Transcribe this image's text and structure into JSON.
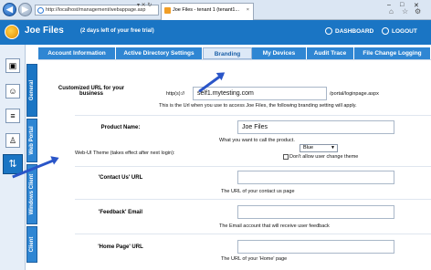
{
  "browser": {
    "url": "http://localhost/management/webappage.asp",
    "tab_title": "Joe Files - tenant 1 (tenant1...",
    "tab_close": "×",
    "win_minimize": "–",
    "win_maximize": "□",
    "win_close": "✕",
    "back_glyph": "◀",
    "forward_glyph": "▶",
    "addr_tools": "▾ ✕ ↻"
  },
  "header": {
    "app_title": "Joe Files",
    "trial_text": "(2 days left of your free trial)",
    "dashboard_label": "DASHBOARD",
    "logout_label": "LOGOUT"
  },
  "vertical_tabs": [
    "General",
    "Web Portal",
    "Windows Client",
    "Client"
  ],
  "tabs": [
    "Account Information",
    "Active Directory Settings",
    "Branding",
    "My Devices",
    "Audit Trace",
    "File Change Logging"
  ],
  "active_tab": "Branding",
  "form": {
    "custom_url": {
      "label": "Customized URL for your business",
      "prefix": "http(s)://",
      "value": "self1.mytesting.com",
      "suffix": "/portal/loginpage.aspx",
      "description": "This is the Url when you use to access Joe Files, the following branding setting will apply."
    },
    "product_name": {
      "label": "Product Name:",
      "value": "Joe Files",
      "description": "What you want to call the product."
    },
    "theme": {
      "label": "Web-UI Theme (takes effect after next login):",
      "selected": "Blue",
      "checkbox_label": "Don't allow user change theme"
    },
    "contact_url": {
      "label": "'Contact Us' URL",
      "value": "",
      "description": "The URL of your contact us page"
    },
    "feedback_email": {
      "label": "'Feedback' Email",
      "value": "",
      "description": "The Email account that will receive user feedback"
    },
    "home_url": {
      "label": "'Home Page' URL",
      "value": "",
      "description": "The URL of your 'Home' page"
    }
  },
  "colors": {
    "brand_blue": "#1a75c4",
    "tab_blue": "#2f86d3",
    "arrow_blue": "#2a55c8"
  },
  "icons": [
    "ie-icon",
    "favicon-icon",
    "dashboard-icon",
    "logout-icon",
    "rail-folder-icon",
    "rail-users-icon",
    "rail-report-icon",
    "rail-user-icon",
    "rail-settings-icon"
  ]
}
